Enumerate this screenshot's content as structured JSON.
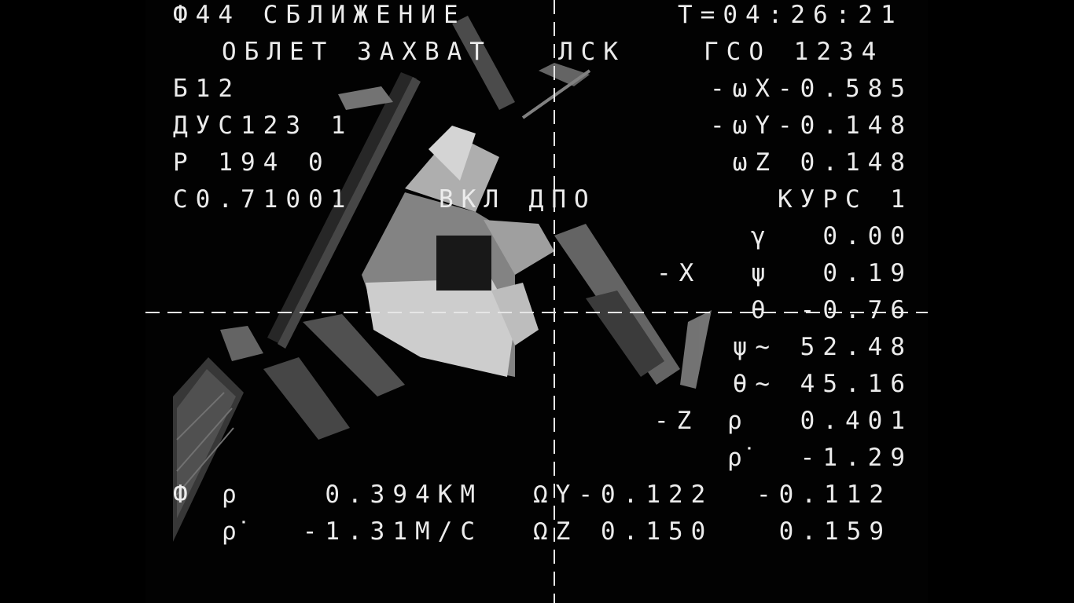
{
  "hud": {
    "mode": "Ф44 СБЛИЖЕНИЕ",
    "timer": "Т=04:26:21",
    "submode": "ОБЛЕТ ЗАХВАТ",
    "frame": "ЛСК",
    "gso": "ГСО 1234",
    "b12": "Б12",
    "dus": "ДУС123 1",
    "p_line": "Р 194 0",
    "c_line": "С0.71001",
    "vkl": "ВКЛ ДПО",
    "omega_x": "-ωX-0.585",
    "omega_y": "-ωY-0.148",
    "omega_z": "ωZ 0.148",
    "kurs": "КУРС 1",
    "gamma_sym": "γ",
    "gamma_val": "0.00",
    "x_label": "-X",
    "psi_sym": "ψ",
    "psi_val": "0.19",
    "theta_sym": "θ",
    "theta_val": "-0.76",
    "psi2": "ψ~ 52.48",
    "theta2": "θ~ 45.16",
    "z_label": "-Z",
    "rho_sym": "ρ",
    "rho_val": "0.401",
    "rhodot_sym": "ρ̇",
    "rhodot_val": "-1.29",
    "phi": "Ф",
    "b_rho_sym": "ρ",
    "b_rho_val": "0.394КМ",
    "b_rhodot_sym": "ρ̇",
    "b_rhodot_val": "-1.31М/С",
    "omega_y_b": "ΩY-0.122",
    "omega_y_b2": "-0.112",
    "omega_z_b": "ΩZ 0.150",
    "omega_z_b2": "0.159"
  }
}
